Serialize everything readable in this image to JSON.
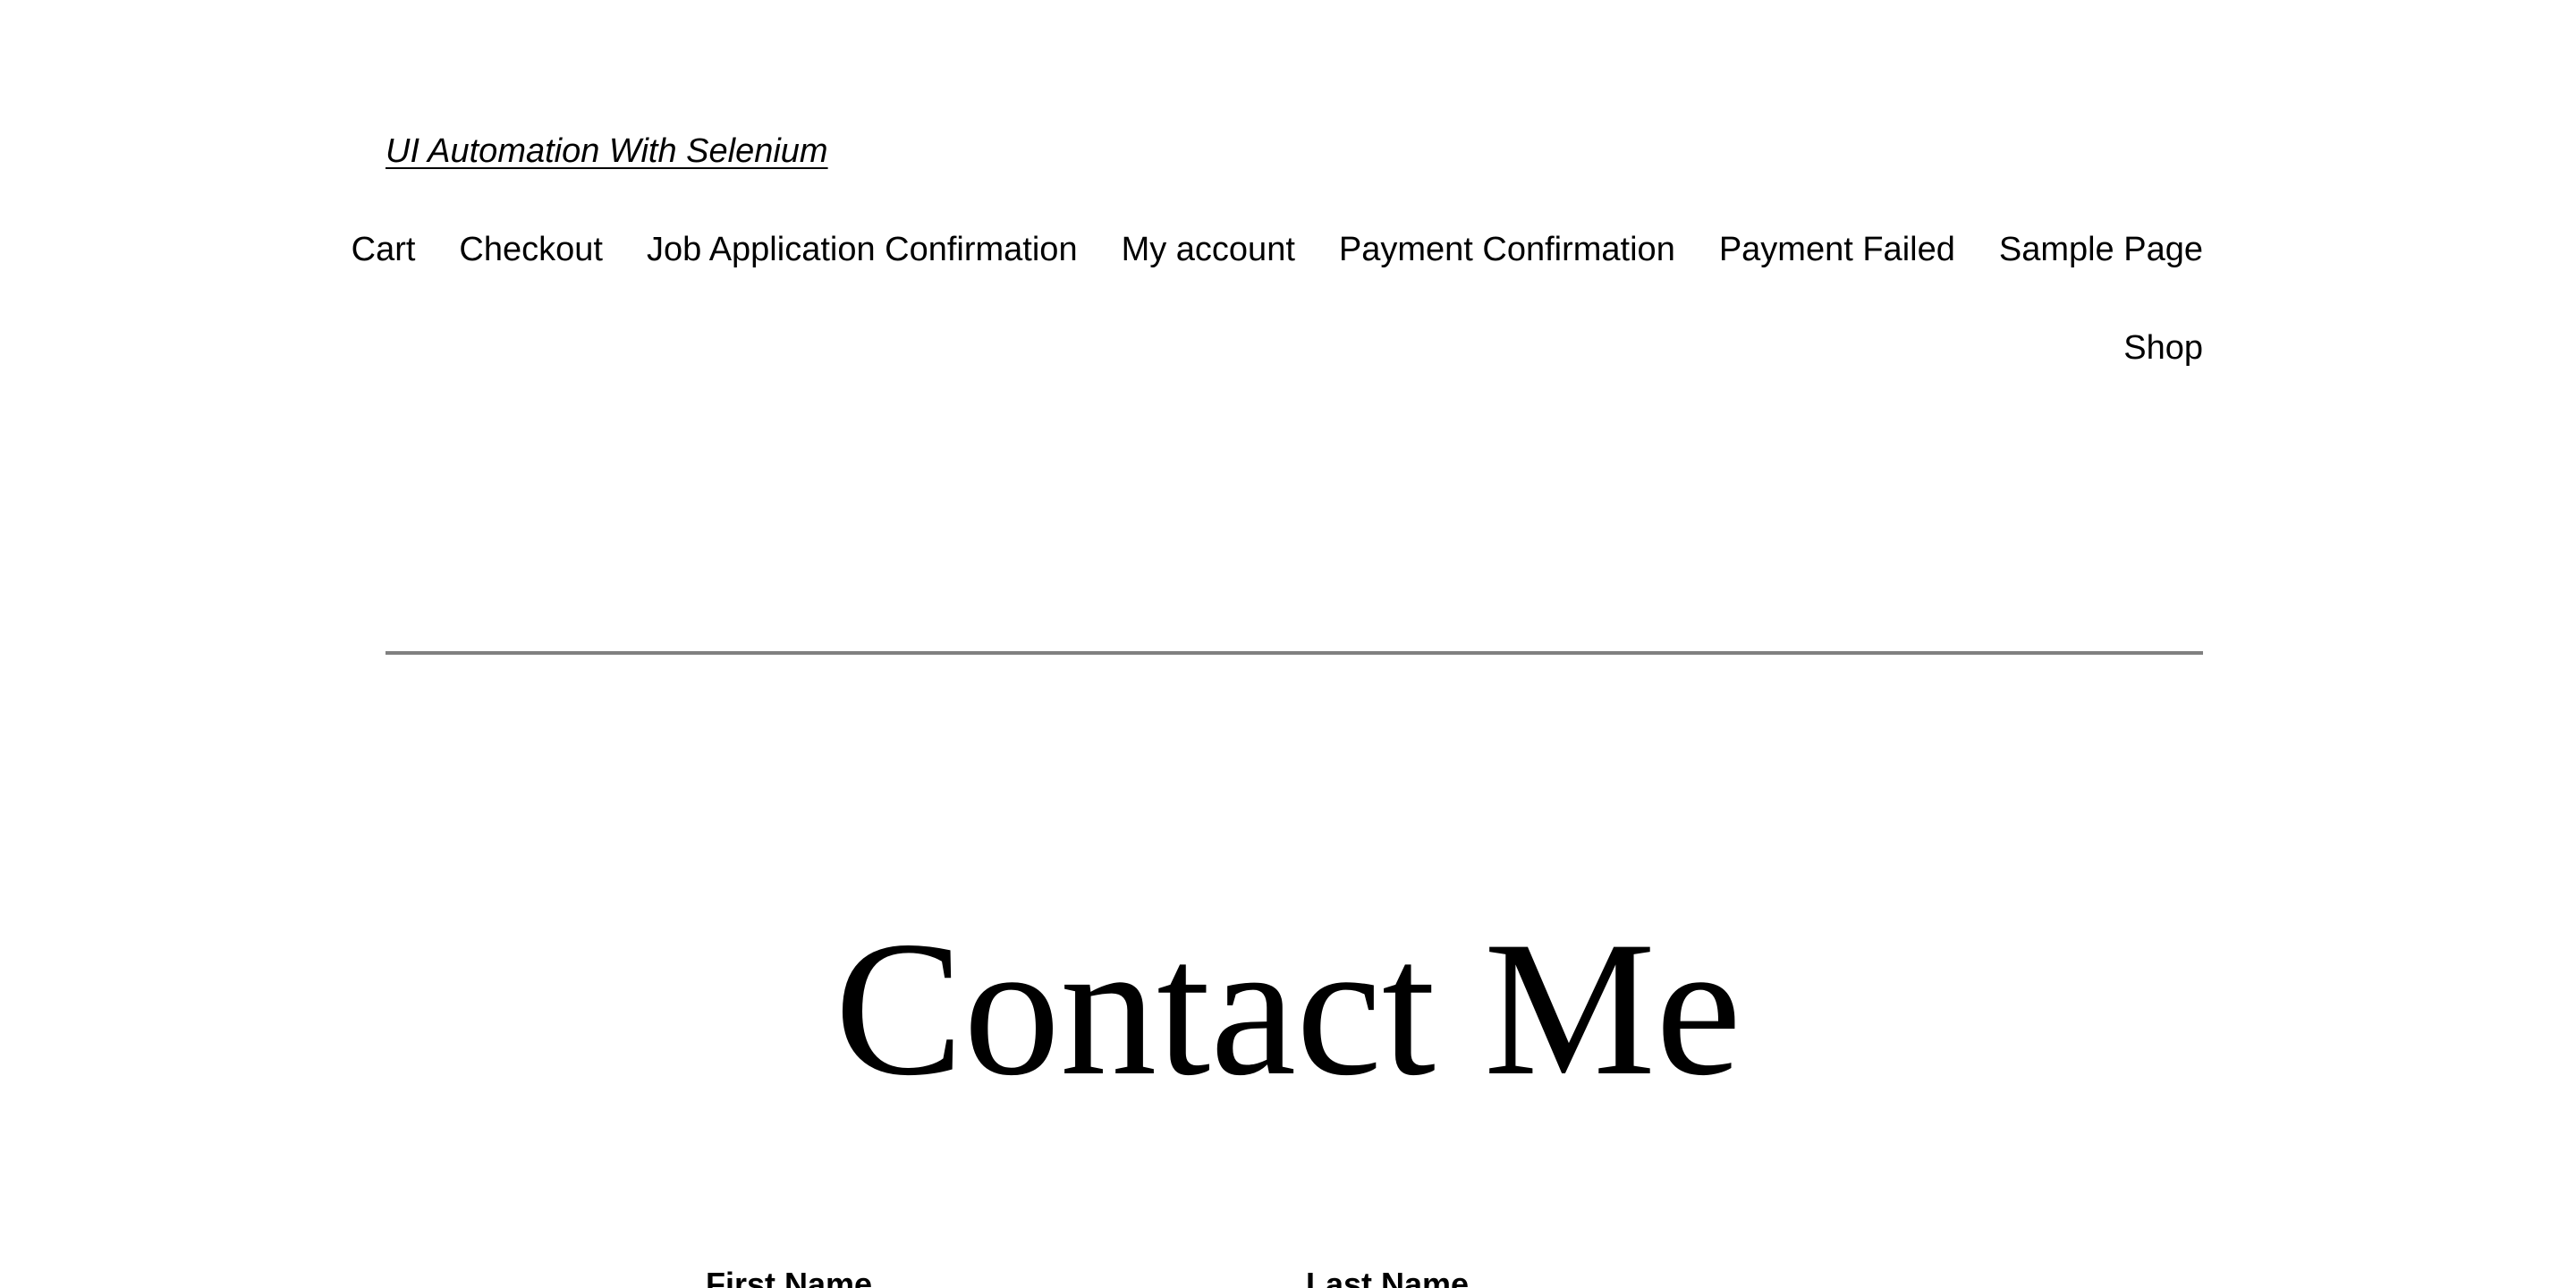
{
  "header": {
    "site_title": "UI Automation With Selenium",
    "nav": [
      {
        "label": "Cart"
      },
      {
        "label": "Checkout"
      },
      {
        "label": "Job Application Confirmation"
      },
      {
        "label": "My account"
      },
      {
        "label": "Payment Confirmation"
      },
      {
        "label": "Payment Failed"
      },
      {
        "label": "Sample Page"
      },
      {
        "label": "Shop"
      }
    ]
  },
  "main": {
    "title": "Contact Me",
    "form": {
      "first_name_label": "First Name",
      "last_name_label": "Last Name"
    }
  }
}
